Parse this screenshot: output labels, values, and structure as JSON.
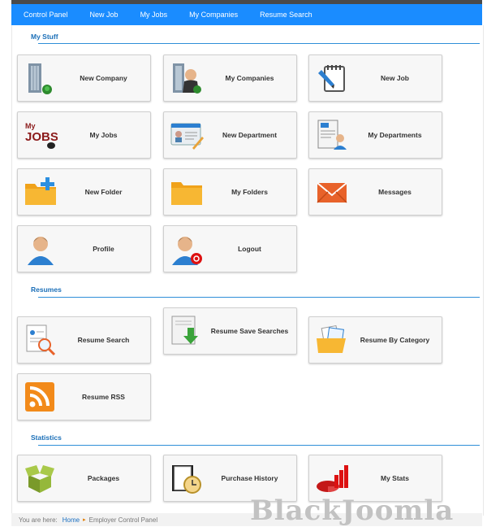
{
  "nav": {
    "items": [
      "Control Panel",
      "New Job",
      "My Jobs",
      "My Companies",
      "Resume Search"
    ]
  },
  "sections": {
    "my_stuff": "My Stuff",
    "resumes": "Resumes",
    "statistics": "Statistics"
  },
  "tiles": {
    "new_company": "New Company",
    "my_companies": "My Companies",
    "new_job": "New Job",
    "my_jobs": "My Jobs",
    "new_department": "New Department",
    "my_departments": "My Departments",
    "new_folder": "New Folder",
    "my_folders": "My Folders",
    "messages": "Messages",
    "profile": "Profile",
    "logout": "Logout",
    "resume_search": "Resume Search",
    "resume_save_searches": "Resume Save Searches",
    "resume_by_category": "Resume By Category",
    "resume_rss": "Resume RSS",
    "packages": "Packages",
    "purchase_history": "Purchase History",
    "my_stats": "My Stats"
  },
  "icon_text": {
    "jobs_small": "My",
    "jobs_big": "JOBS"
  },
  "breadcrumb": {
    "lead": "You are here:",
    "home": "Home",
    "current": "Employer Control Panel"
  },
  "watermark": "BlackJoomla",
  "colors": {
    "nav": "#1a8cff",
    "section": "#1b6fb8",
    "accent": "#e07b00"
  }
}
